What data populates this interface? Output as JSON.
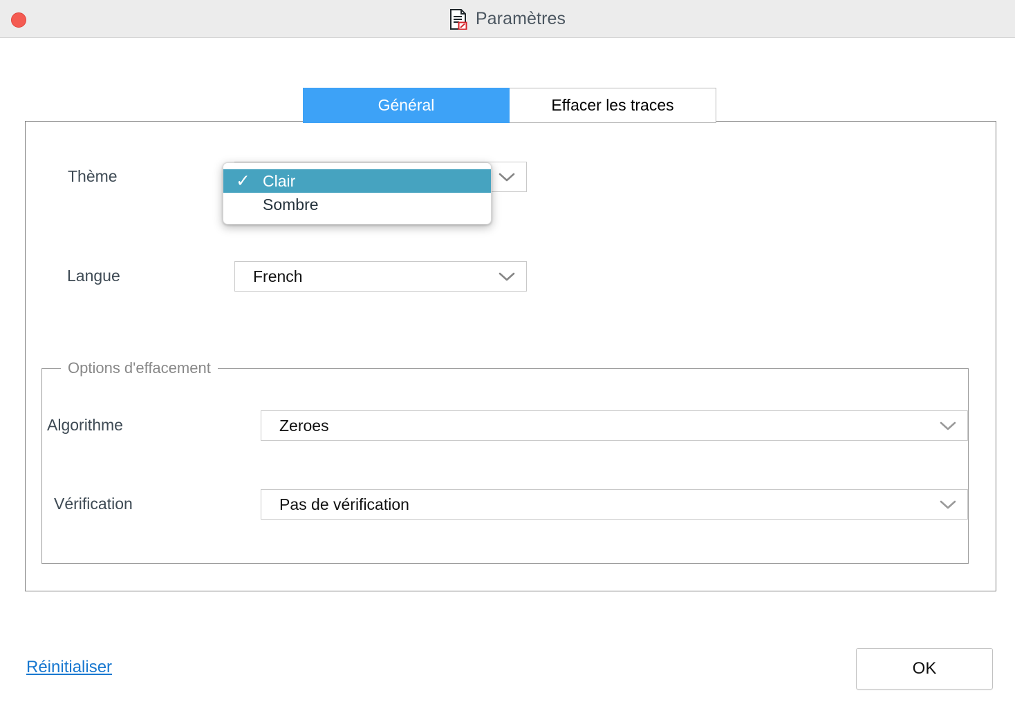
{
  "window": {
    "title": "Paramètres",
    "title_icon": "document-eraser-icon",
    "close_button_icon": "close-window-dot",
    "titlebar_bg": "#ececec"
  },
  "tabs": {
    "active_index": 0,
    "items": [
      {
        "label": "Général",
        "active": true
      },
      {
        "label": "Effacer les traces",
        "active": false
      }
    ],
    "active_color": "#3da2f7"
  },
  "general": {
    "theme": {
      "label": "Thème",
      "value": "Clair",
      "chevron_icon": "chevron-down-icon",
      "dropdown_open": true,
      "options": [
        {
          "label": "Clair",
          "selected": true,
          "check_icon": "check-icon"
        },
        {
          "label": "Sombre",
          "selected": false,
          "check_icon": ""
        }
      ],
      "highlight_color": "#46a3c0"
    },
    "language": {
      "label": "Langue",
      "value": "French",
      "chevron_icon": "chevron-down-icon"
    }
  },
  "erase_options": {
    "group_title": "Options d'effacement",
    "algorithm": {
      "label": "Algorithme",
      "value": "Zeroes",
      "chevron_icon": "chevron-down-icon"
    },
    "verification": {
      "label": "Vérification",
      "value": "Pas de vérification",
      "chevron_icon": "chevron-down-icon"
    }
  },
  "footer": {
    "reset_label": "Réinitialiser",
    "reset_color": "#1878d0",
    "ok_label": "OK"
  }
}
